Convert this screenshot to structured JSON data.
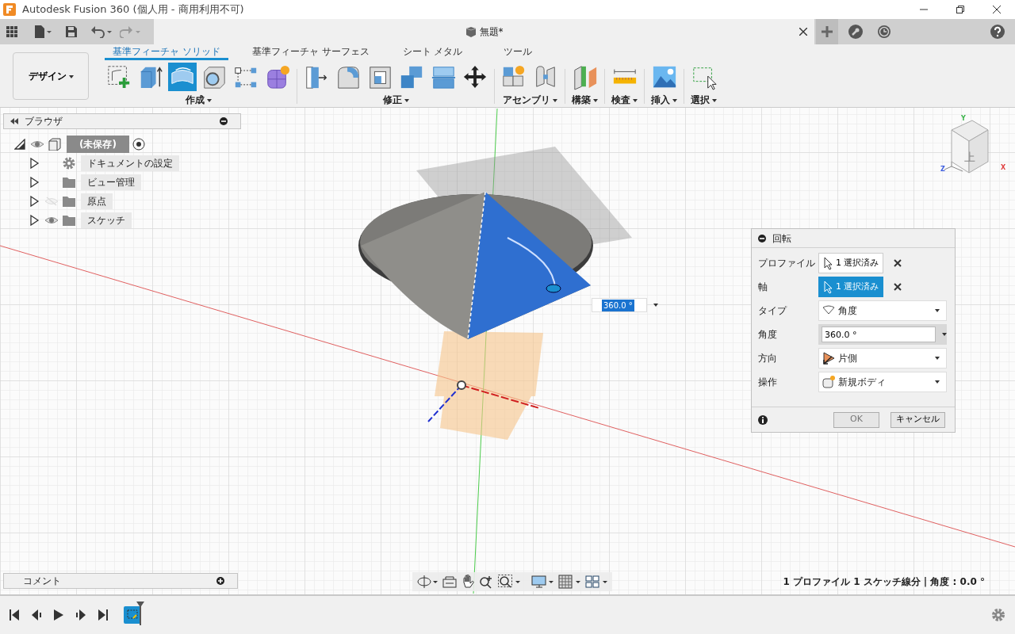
{
  "window": {
    "title": "Autodesk Fusion 360 (個人用 - 商用利用不可)"
  },
  "document_tab": {
    "title": "無題*"
  },
  "workspace": {
    "label": "デザイン"
  },
  "ribbon_tabs": [
    {
      "label": "基準フィーチャ ソリッド",
      "selected": true
    },
    {
      "label": "基準フィーチャ サーフェス",
      "selected": false
    },
    {
      "label": "シート メタル",
      "selected": false
    },
    {
      "label": "ツール",
      "selected": false
    }
  ],
  "ribbon_groups": [
    {
      "label": "作成",
      "tools": [
        {
          "kind": "sketch",
          "selected": false
        },
        {
          "kind": "extrude",
          "selected": false
        },
        {
          "kind": "revolve",
          "selected": true
        },
        {
          "kind": "hole",
          "selected": false
        },
        {
          "kind": "pattern",
          "selected": false
        },
        {
          "kind": "form",
          "selected": false
        }
      ]
    },
    {
      "label": "修正",
      "tools": [
        {
          "kind": "presspull",
          "selected": false
        },
        {
          "kind": "fillet",
          "selected": false
        },
        {
          "kind": "shell",
          "selected": false
        },
        {
          "kind": "combine",
          "selected": false
        },
        {
          "kind": "split",
          "selected": false
        },
        {
          "kind": "move",
          "selected": false
        }
      ]
    },
    {
      "label": "アセンブリ",
      "tools": [
        {
          "kind": "component",
          "selected": false
        },
        {
          "kind": "joint",
          "selected": false
        }
      ]
    },
    {
      "label": "構築",
      "tools": [
        {
          "kind": "plane",
          "selected": false
        }
      ]
    },
    {
      "label": "検査",
      "tools": [
        {
          "kind": "measure",
          "selected": false
        }
      ]
    },
    {
      "label": "挿入",
      "tools": [
        {
          "kind": "image",
          "selected": false
        }
      ]
    },
    {
      "label": "選択",
      "tools": [
        {
          "kind": "select",
          "selected": false
        }
      ]
    }
  ],
  "browser": {
    "title": "ブラウザ",
    "items": [
      {
        "label": "(未保存)",
        "kind": "component",
        "visible": true,
        "expanded": true,
        "children": [
          {
            "label": "ドキュメントの設定",
            "kind": "settings",
            "expanded": false
          },
          {
            "label": "ビュー管理",
            "kind": "folder",
            "expanded": false
          },
          {
            "label": "原点",
            "kind": "folder",
            "visible": false,
            "expanded": false
          },
          {
            "label": "スケッチ",
            "kind": "folder",
            "visible": true,
            "expanded": false
          }
        ]
      }
    ]
  },
  "view_cube": {
    "face_label": "上",
    "axes": [
      {
        "label": "Y",
        "color": "#3cb44b"
      },
      {
        "label": "X",
        "color": "#e04040"
      },
      {
        "label": "Z",
        "color": "#4060e0"
      }
    ]
  },
  "dimension_input": {
    "value": "360.0 °"
  },
  "dialog": {
    "title": "回転",
    "rows": [
      {
        "label": "プロファイル",
        "kind": "selection",
        "value": "1 選択済み",
        "selected": false
      },
      {
        "label": "軸",
        "kind": "selection",
        "value": "1 選択済み",
        "selected": true
      },
      {
        "label": "タイプ",
        "kind": "dropdown",
        "value": "角度"
      },
      {
        "label": "角度",
        "kind": "number",
        "value": "360.0 °"
      },
      {
        "label": "方向",
        "kind": "dropdown",
        "value": "片側"
      },
      {
        "label": "操作",
        "kind": "dropdown",
        "value": "新規ボディ"
      }
    ],
    "buttons": [
      {
        "label": "OK"
      },
      {
        "label": "キャンセル"
      }
    ]
  },
  "comments": {
    "title": "コメント"
  },
  "status_text": "1 プロファイル 1 スケッチ線分 | 角度 : 0.0 °",
  "timeline": {
    "features": [
      {
        "selected": true
      }
    ]
  }
}
